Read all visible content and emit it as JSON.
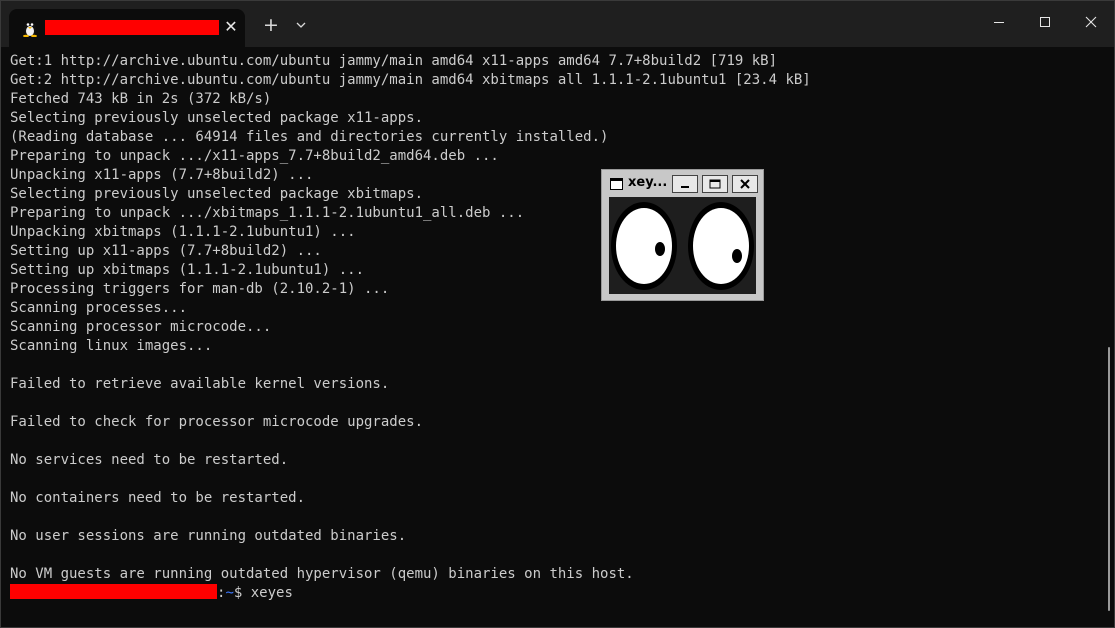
{
  "tabbar": {
    "new_tab_label": "+",
    "close_label": "✕"
  },
  "terminal": {
    "lines": [
      "Get:1 http://archive.ubuntu.com/ubuntu jammy/main amd64 x11-apps amd64 7.7+8build2 [719 kB]",
      "Get:2 http://archive.ubuntu.com/ubuntu jammy/main amd64 xbitmaps all 1.1.1-2.1ubuntu1 [23.4 kB]",
      "Fetched 743 kB in 2s (372 kB/s)",
      "Selecting previously unselected package x11-apps.",
      "(Reading database ... 64914 files and directories currently installed.)",
      "Preparing to unpack .../x11-apps_7.7+8build2_amd64.deb ...",
      "Unpacking x11-apps (7.7+8build2) ...",
      "Selecting previously unselected package xbitmaps.",
      "Preparing to unpack .../xbitmaps_1.1.1-2.1ubuntu1_all.deb ...",
      "Unpacking xbitmaps (1.1.1-2.1ubuntu1) ...",
      "Setting up x11-apps (7.7+8build2) ...",
      "Setting up xbitmaps (1.1.1-2.1ubuntu1) ...",
      "Processing triggers for man-db (2.10.2-1) ...",
      "Scanning processes...",
      "Scanning processor microcode...",
      "Scanning linux images...",
      "",
      "Failed to retrieve available kernel versions.",
      "",
      "Failed to check for processor microcode upgrades.",
      "",
      "No services need to be restarted.",
      "",
      "No containers need to be restarted.",
      "",
      "No user sessions are running outdated binaries.",
      "",
      "No VM guests are running outdated hypervisor (qemu) binaries on this host."
    ],
    "prompt": {
      "separator": ":",
      "path": "~",
      "symbol": "$ ",
      "command": "xeyes"
    }
  },
  "xeyes": {
    "title": "xey..."
  },
  "colors": {
    "background": "#0c0c0c",
    "foreground": "#cccccc",
    "prompt_path": "#3b78ff",
    "redaction": "#ff0000",
    "titlebar": "#1f1f1f"
  }
}
